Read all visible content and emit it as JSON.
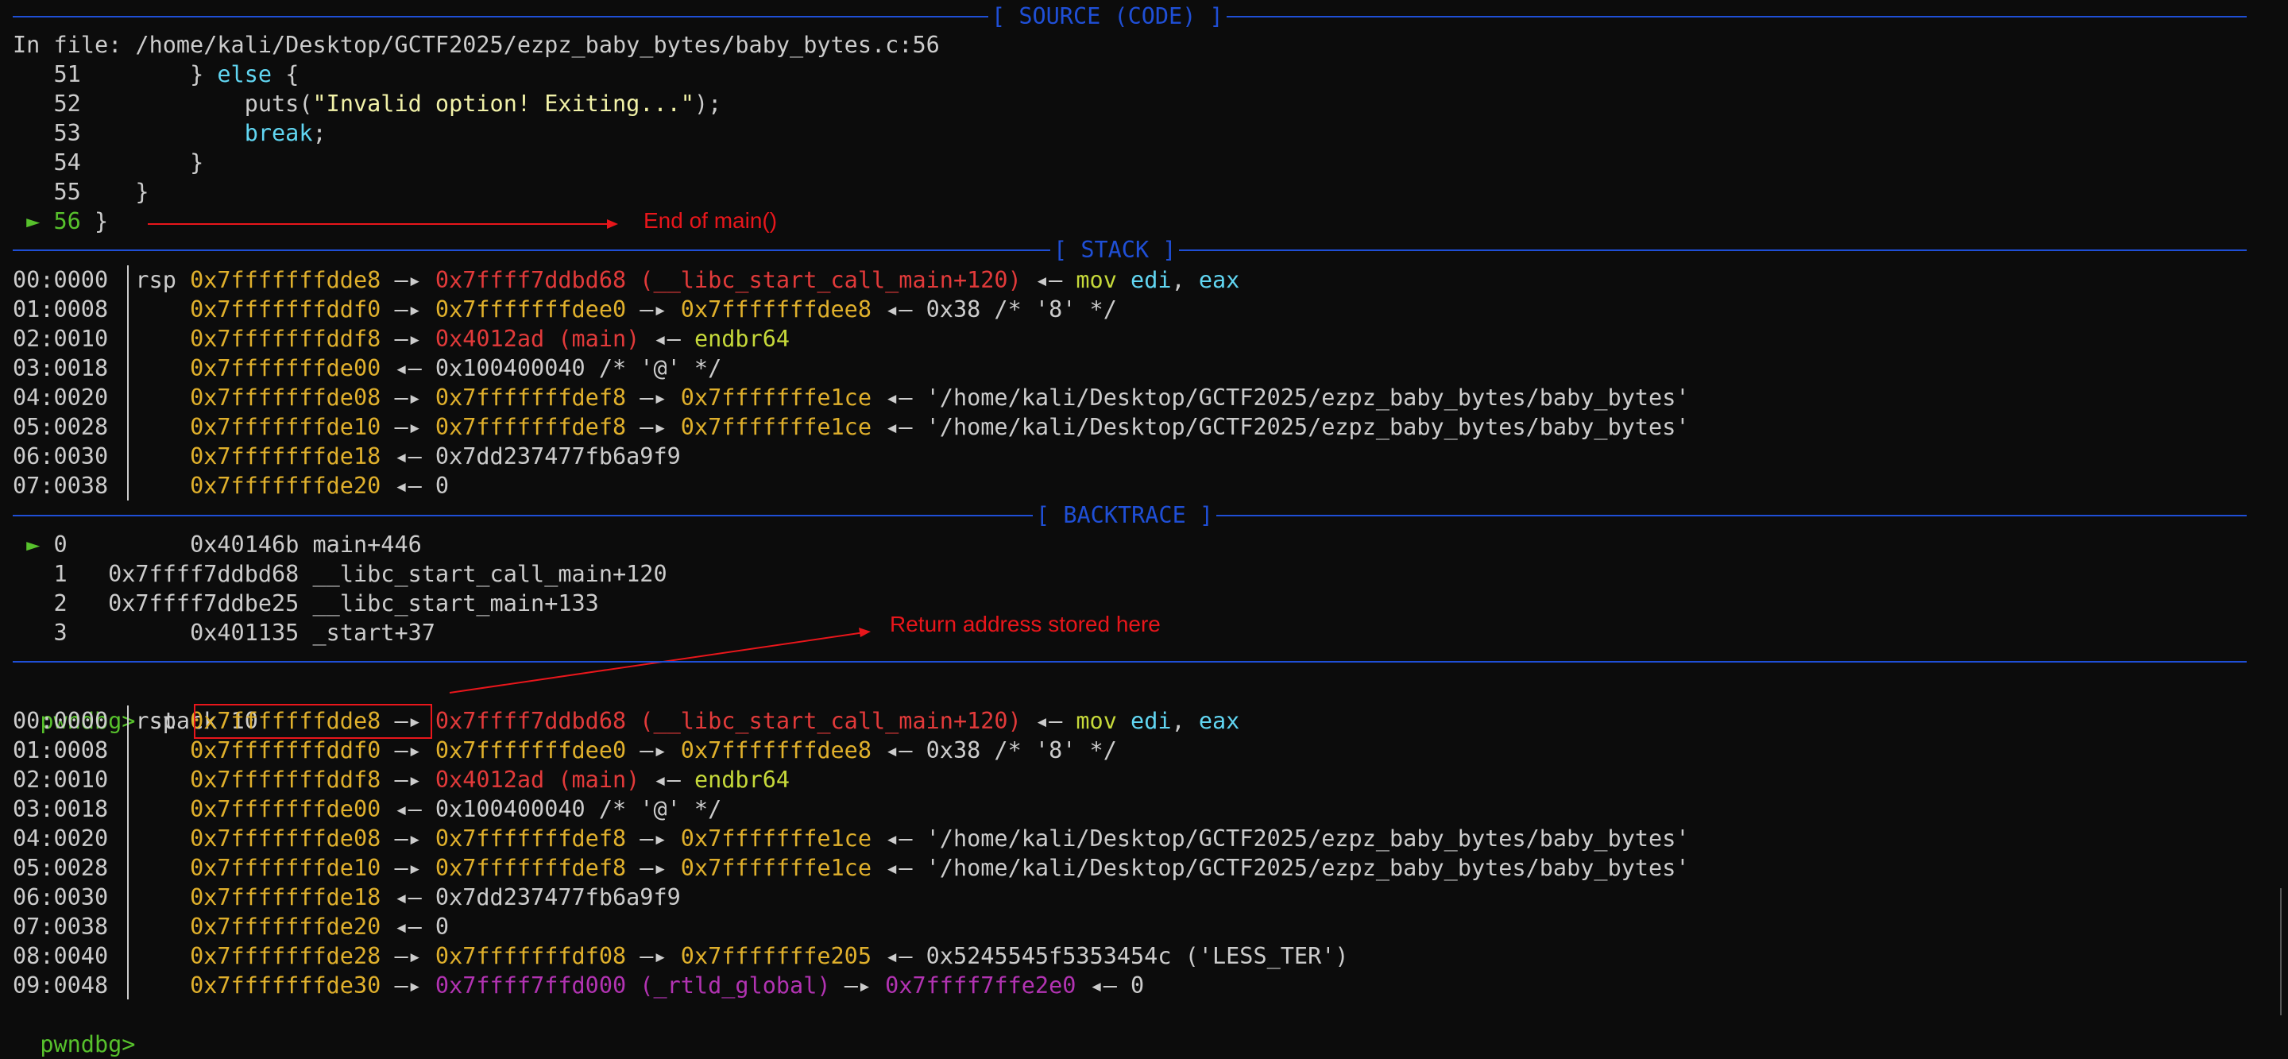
{
  "section_titles": {
    "source": "[ SOURCE (CODE) ]",
    "stack": "[ STACK ]",
    "backtrace": "[ BACKTRACE ]"
  },
  "source": {
    "file_line": "In file: /home/kali/Desktop/GCTF2025/ezpz_baby_bytes/baby_bytes.c:56",
    "lines": [
      {
        "num": "51",
        "pre": "        } ",
        "kw": "else",
        "post": " {"
      },
      {
        "num": "52",
        "pre": "            puts(",
        "str": "\"Invalid option! Exiting...\"",
        "post": ");"
      },
      {
        "num": "53",
        "pre": "            ",
        "kw": "break",
        "post": ";"
      },
      {
        "num": "54",
        "pre": "        }"
      },
      {
        "num": "55",
        "pre": "    }"
      },
      {
        "num": "56",
        "pre": " }",
        "current": true
      }
    ],
    "current_marker": "►"
  },
  "stack_rows": [
    {
      "offset": "00:0000",
      "reg": "rsp",
      "addr": "0x7fffffffdde8",
      "arrow1": "—▸",
      "val1": "0x7ffff7ddbd68 (__libc_start_call_main+120)",
      "val1_color": "#e23a3a",
      "tail_arrow": "◂—",
      "instr": "mov",
      "op1": "edi",
      "op2": "eax"
    },
    {
      "offset": "01:0008",
      "addr": "0x7fffffffddf0",
      "arrow1": "—▸",
      "val1": "0x7fffffffdee0",
      "val1_color": "#e0b02c",
      "arrow2": "—▸",
      "val2": "0x7fffffffdee8",
      "val2_color": "#e0b02c",
      "tail_arrow": "◂—",
      "tail": "0x38 /* '8' */"
    },
    {
      "offset": "02:0010",
      "addr": "0x7fffffffddf8",
      "arrow1": "—▸",
      "val1": "0x4012ad (main)",
      "val1_color": "#e23a3a",
      "tail_arrow": "◂—",
      "instr": "endbr64"
    },
    {
      "offset": "03:0018",
      "addr": "0x7fffffffde00",
      "tail_arrow": "◂—",
      "tail": "0x100400040 /* '@' */"
    },
    {
      "offset": "04:0020",
      "addr": "0x7fffffffde08",
      "arrow1": "—▸",
      "val1": "0x7fffffffdef8",
      "val1_color": "#e0b02c",
      "arrow2": "—▸",
      "val2": "0x7fffffffe1ce",
      "val2_color": "#e0b02c",
      "tail_arrow": "◂—",
      "tail": "'/home/kali/Desktop/GCTF2025/ezpz_baby_bytes/baby_bytes'"
    },
    {
      "offset": "05:0028",
      "addr": "0x7fffffffde10",
      "arrow1": "—▸",
      "val1": "0x7fffffffdef8",
      "val1_color": "#e0b02c",
      "arrow2": "—▸",
      "val2": "0x7fffffffe1ce",
      "val2_color": "#e0b02c",
      "tail_arrow": "◂—",
      "tail": "'/home/kali/Desktop/GCTF2025/ezpz_baby_bytes/baby_bytes'"
    },
    {
      "offset": "06:0030",
      "addr": "0x7fffffffde18",
      "tail_arrow": "◂—",
      "tail": "0x7dd237477fb6a9f9"
    },
    {
      "offset": "07:0038",
      "addr": "0x7fffffffde20",
      "tail_arrow": "◂—",
      "tail": "0"
    }
  ],
  "backtrace": [
    {
      "marker": "►",
      "index": "0",
      "addr": "      0x40146b",
      "sym": "main+446"
    },
    {
      "marker": "",
      "index": "1",
      "addr": "0x7ffff7ddbd68",
      "sym": "__libc_start_call_main+120"
    },
    {
      "marker": "",
      "index": "2",
      "addr": "0x7ffff7ddbe25",
      "sym": "__libc_start_main+133"
    },
    {
      "marker": "",
      "index": "3",
      "addr": "      0x401135",
      "sym": "_start+37"
    }
  ],
  "prompt": {
    "label": "pwndbg>",
    "command": "stack 10"
  },
  "stack10_rows": [
    {
      "offset": "00:0000",
      "reg": "rsp",
      "addr": "0x7fffffffdde8",
      "arrow1": "—▸",
      "val1": "0x7ffff7ddbd68 (__libc_start_call_main+120)",
      "val1_color": "#e23a3a",
      "tail_arrow": "◂—",
      "instr": "mov",
      "op1": "edi",
      "op2": "eax"
    },
    {
      "offset": "01:0008",
      "addr": "0x7fffffffddf0",
      "arrow1": "—▸",
      "val1": "0x7fffffffdee0",
      "val1_color": "#e0b02c",
      "arrow2": "—▸",
      "val2": "0x7fffffffdee8",
      "val2_color": "#e0b02c",
      "tail_arrow": "◂—",
      "tail": "0x38 /* '8' */"
    },
    {
      "offset": "02:0010",
      "addr": "0x7fffffffddf8",
      "arrow1": "—▸",
      "val1": "0x4012ad (main)",
      "val1_color": "#e23a3a",
      "tail_arrow": "◂—",
      "instr": "endbr64"
    },
    {
      "offset": "03:0018",
      "addr": "0x7fffffffde00",
      "tail_arrow": "◂—",
      "tail": "0x100400040 /* '@' */"
    },
    {
      "offset": "04:0020",
      "addr": "0x7fffffffde08",
      "arrow1": "—▸",
      "val1": "0x7fffffffdef8",
      "val1_color": "#e0b02c",
      "arrow2": "—▸",
      "val2": "0x7fffffffe1ce",
      "val2_color": "#e0b02c",
      "tail_arrow": "◂—",
      "tail": "'/home/kali/Desktop/GCTF2025/ezpz_baby_bytes/baby_bytes'"
    },
    {
      "offset": "05:0028",
      "addr": "0x7fffffffde10",
      "arrow1": "—▸",
      "val1": "0x7fffffffdef8",
      "val1_color": "#e0b02c",
      "arrow2": "—▸",
      "val2": "0x7fffffffe1ce",
      "val2_color": "#e0b02c",
      "tail_arrow": "◂—",
      "tail": "'/home/kali/Desktop/GCTF2025/ezpz_baby_bytes/baby_bytes'"
    },
    {
      "offset": "06:0030",
      "addr": "0x7fffffffde18",
      "tail_arrow": "◂—",
      "tail": "0x7dd237477fb6a9f9"
    },
    {
      "offset": "07:0038",
      "addr": "0x7fffffffde20",
      "tail_arrow": "◂—",
      "tail": "0"
    },
    {
      "offset": "08:0040",
      "addr": "0x7fffffffde28",
      "arrow1": "—▸",
      "val1": "0x7fffffffdf08",
      "val1_color": "#e0b02c",
      "arrow2": "—▸",
      "val2": "0x7fffffffe205",
      "val2_color": "#e0b02c",
      "tail_arrow": "◂—",
      "tail": "0x5245545f5353454c ('LESS_TER')"
    },
    {
      "offset": "09:0048",
      "addr": "0x7fffffffde30",
      "arrow1": "—▸",
      "val1": "0x7ffff7ffd000 (_rtld_global)",
      "val1_color": "#b233b2",
      "arrow2": "—▸",
      "val2": "0x7ffff7ffe2e0",
      "val2_color": "#b233b2",
      "tail_arrow": "◂—",
      "tail": "0"
    }
  ],
  "final_prompt": "pwndbg>",
  "annotations": {
    "end_of_main": "End of main()",
    "return_address": "Return address stored here"
  },
  "colors": {
    "background": "#0c0c0c",
    "separator": "#1f4fd6",
    "stack_addr": "#e0b02c",
    "code_ptr": "#e23a3a",
    "annotation": "#e8161b",
    "prompt": "#57c12c"
  }
}
